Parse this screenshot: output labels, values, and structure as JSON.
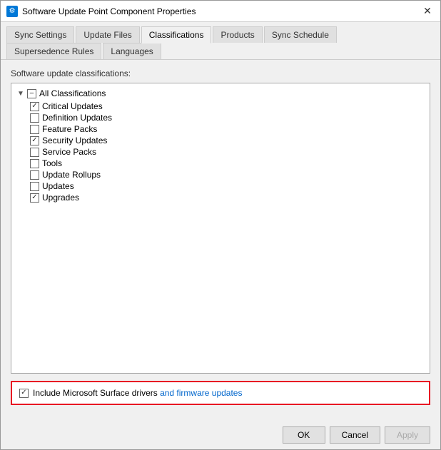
{
  "window": {
    "title": "Software Update Point Component Properties",
    "icon": "⚙"
  },
  "tabs": [
    {
      "label": "Sync Settings",
      "active": false
    },
    {
      "label": "Update Files",
      "active": false
    },
    {
      "label": "Classifications",
      "active": true
    },
    {
      "label": "Products",
      "active": false
    },
    {
      "label": "Sync Schedule",
      "active": false
    },
    {
      "label": "Supersedence Rules",
      "active": false
    },
    {
      "label": "Languages",
      "active": false
    }
  ],
  "section_label": "Software update classifications:",
  "tree": {
    "root_label": "All Classifications",
    "root_state": "indeterminate",
    "items": [
      {
        "label": "Critical Updates",
        "checked": true
      },
      {
        "label": "Definition Updates",
        "checked": false
      },
      {
        "label": "Feature Packs",
        "checked": false
      },
      {
        "label": "Security Updates",
        "checked": true
      },
      {
        "label": "Service Packs",
        "checked": false
      },
      {
        "label": "Tools",
        "checked": false
      },
      {
        "label": "Update Rollups",
        "checked": false
      },
      {
        "label": "Updates",
        "checked": false
      },
      {
        "label": "Upgrades",
        "checked": true
      }
    ]
  },
  "surface_drivers": {
    "label_plain": "Include Microsoft Surface drivers ",
    "label_blue": "and firmware updates",
    "checked": true
  },
  "footer": {
    "ok_label": "OK",
    "cancel_label": "Cancel",
    "apply_label": "Apply"
  }
}
